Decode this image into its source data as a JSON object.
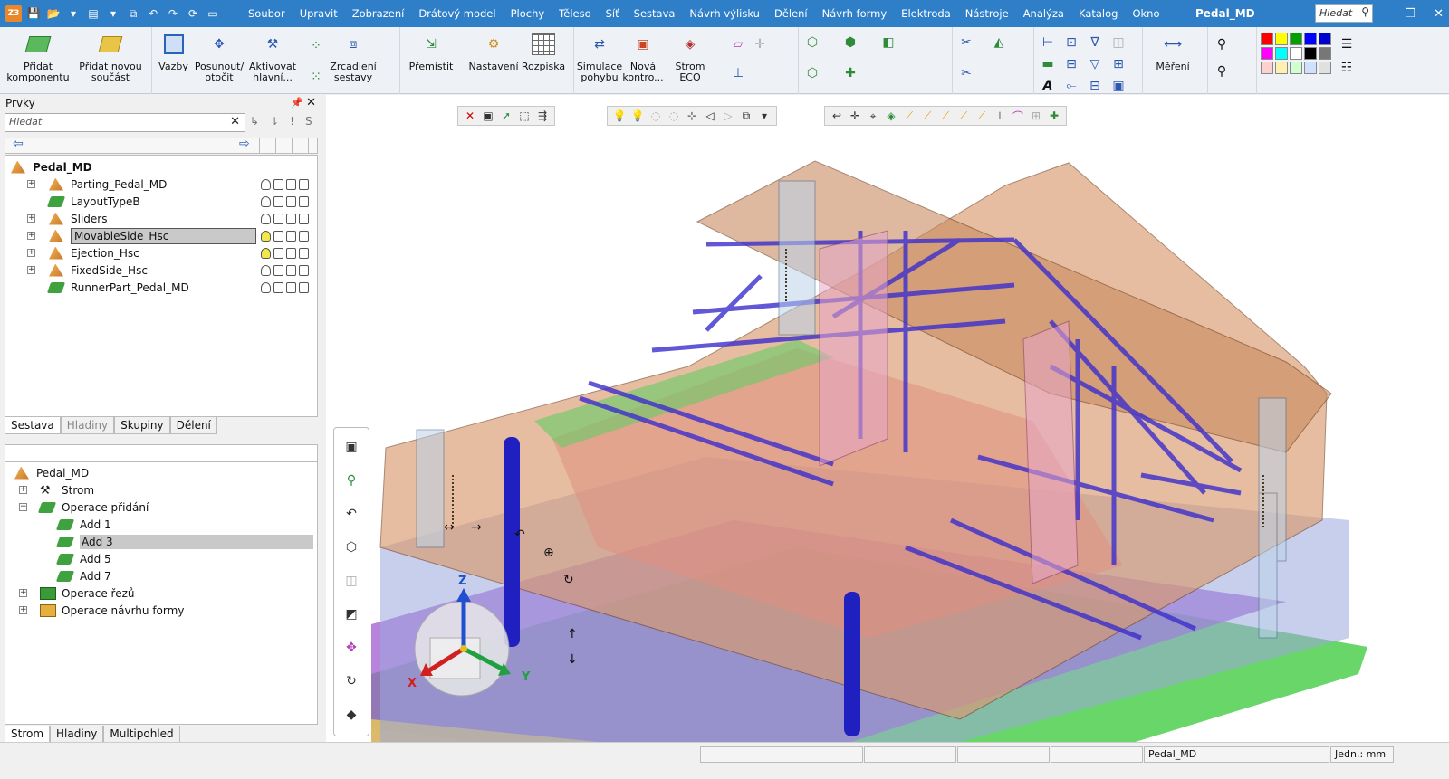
{
  "app": {
    "doc_title": "Pedal_MD",
    "search_placeholder": "Hledat",
    "menu": [
      "Soubor",
      "Upravit",
      "Zobrazení",
      "Drátový model",
      "Plochy",
      "Těleso",
      "Síť",
      "Sestava",
      "Návrh výlisku",
      "Dělení",
      "Návrh formy",
      "Elektroda",
      "Nástroje",
      "Analýza",
      "Katalog",
      "Okno"
    ]
  },
  "ribbon": {
    "add_component": "Přidat komponentu",
    "add_new_part": "Přidat novou součást",
    "constraints": "Vazby",
    "move_rotate": "Posunout/ otočit",
    "activate_main": "Aktivovat hlavní...",
    "mirror_assembly": "Zrcadlení sestavy",
    "relocate": "Přemístit",
    "settings": "Nastavení",
    "bom": "Rozpiska",
    "motion_sim": "Simulace pohybu",
    "new_check": "Nová kontro...",
    "eco_tree": "Strom ECO",
    "measure": "Měření",
    "palette": [
      "#ff0000",
      "#ffff00",
      "#00a000",
      "#0000ff",
      "#0000cc",
      "#ff00ff",
      "#00ffff",
      "#ffffff",
      "#000000",
      "#777777",
      "#ffd0d0",
      "#fff0b0",
      "#d0ffd0",
      "#d0e0ff",
      "#e0e0e0",
      "#f0d0f0",
      "#d0f0f0",
      "#f8f8f8",
      "#eeeeee",
      "#f4f4f4"
    ]
  },
  "features_panel": {
    "title": "Prvky",
    "search_placeholder": "Hledat",
    "filter_buttons": [
      "↳",
      "⇂",
      "!",
      "S"
    ],
    "root": "Pedal_MD",
    "items": [
      {
        "label": "Parting_Pedal_MD",
        "expandable": true,
        "kind": "assembly"
      },
      {
        "label": "LayoutTypeB",
        "expandable": false,
        "kind": "part"
      },
      {
        "label": "Sliders",
        "expandable": true,
        "kind": "assembly"
      },
      {
        "label": "MovableSide_Hsc",
        "expandable": true,
        "kind": "assembly",
        "selected": true
      },
      {
        "label": "Ejection_Hsc",
        "expandable": true,
        "kind": "assembly"
      },
      {
        "label": "FixedSide_Hsc",
        "expandable": true,
        "kind": "assembly"
      },
      {
        "label": "RunnerPart_Pedal_MD",
        "expandable": false,
        "kind": "part"
      }
    ],
    "tabs": [
      "Sestava",
      "Hladiny",
      "Skupiny",
      "Dělení"
    ]
  },
  "history_panel": {
    "root": "Pedal_MD",
    "items": [
      {
        "label": "Strom",
        "level": 1,
        "expander": "+"
      },
      {
        "label": "Operace přidání",
        "level": 1,
        "expander": "-"
      },
      {
        "label": "Add 1",
        "level": 2
      },
      {
        "label": "Add 3",
        "level": 2,
        "selected": true
      },
      {
        "label": "Add 5",
        "level": 2
      },
      {
        "label": "Add 7",
        "level": 2
      },
      {
        "label": "Operace řezů",
        "level": 1,
        "expander": "+"
      },
      {
        "label": "Operace návrhu formy",
        "level": 1,
        "expander": "+"
      }
    ],
    "tabs": [
      "Strom",
      "Hladiny",
      "Multipohled"
    ]
  },
  "viewport": {
    "triad": {
      "x": "X",
      "y": "Y",
      "z": "Z"
    }
  },
  "statusbar": {
    "doc": "Pedal_MD",
    "units": "Jedn.: mm"
  }
}
